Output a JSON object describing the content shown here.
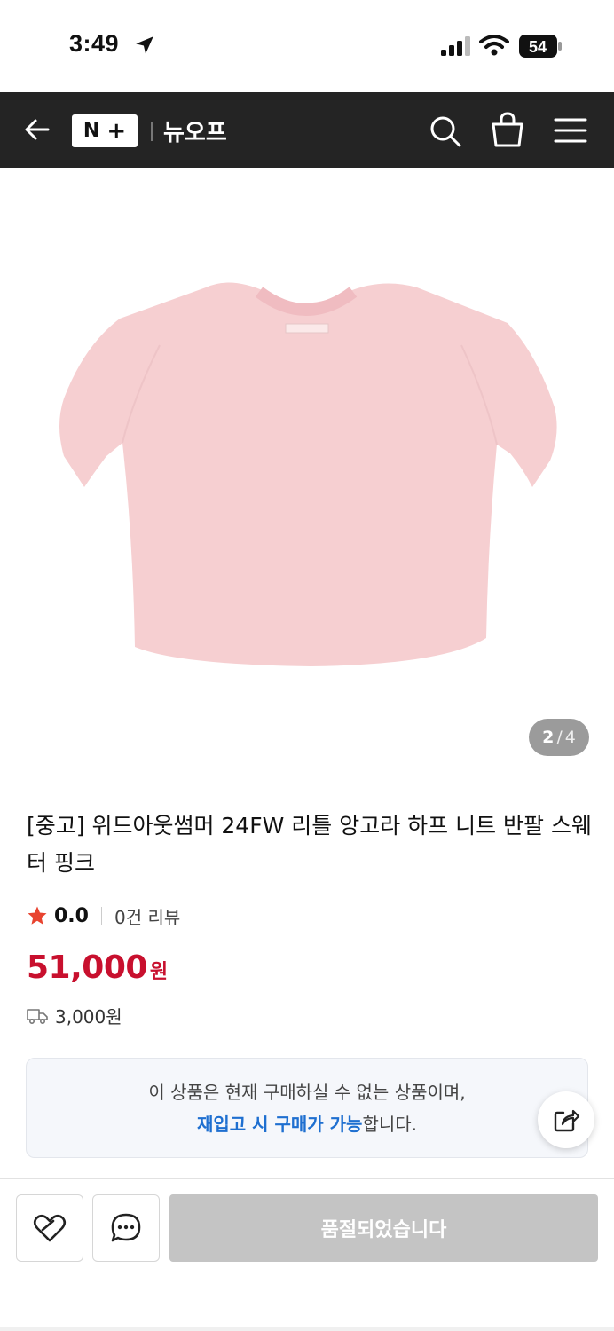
{
  "status_bar": {
    "time": "3:49",
    "battery": "54",
    "icons": [
      "location-arrow-icon",
      "signal-icon",
      "wifi-icon",
      "battery-icon"
    ]
  },
  "header": {
    "logo_n": "N",
    "logo_plus": "+",
    "brand": "뉴오프",
    "icons": [
      "back-arrow-icon",
      "search-icon",
      "shopping-bag-icon",
      "menu-icon"
    ],
    "background": "#242424"
  },
  "gallery": {
    "current": "2",
    "separator": "/",
    "total": "4",
    "sweater_color": "#f6cfd1"
  },
  "product": {
    "title": "[중고] 위드아웃썸머 24FW 리틀 앙고라 하프 니트 반팔 스웨터 핑크",
    "rating": "0.0",
    "review_count": "0건 리뷰",
    "price": "51,000",
    "price_unit": "원",
    "shipping_fee": "3,000원",
    "price_color": "#c8102e"
  },
  "notice": {
    "line1": "이 상품은 현재 구매하실 수 없는 상품이며,",
    "line2_highlight": "재입고 시 구매가 가능",
    "line2_rest": "합니다.",
    "highlight_color": "#1e6fd0"
  },
  "actions": {
    "soldout_label": "품절되었습니다",
    "icons": [
      "heart-icon",
      "chat-icon",
      "share-icon"
    ]
  }
}
